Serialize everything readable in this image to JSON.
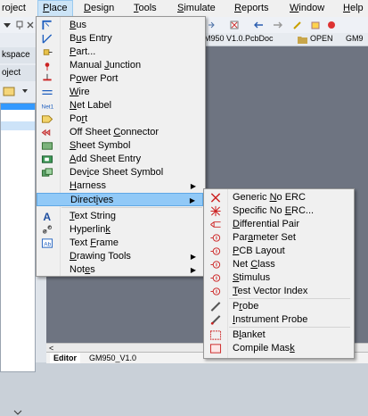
{
  "menubar": {
    "items": [
      {
        "label": "roject"
      },
      {
        "label": "Place",
        "acc": "P",
        "rest": "lace"
      },
      {
        "label": "Design",
        "acc": "D",
        "rest": "esign"
      },
      {
        "label": "Tools",
        "acc": "T",
        "rest": "ools"
      },
      {
        "label": "Simulate",
        "acc": "S",
        "rest": "imulate"
      },
      {
        "label": "Reports",
        "acc": "R",
        "rest": "eports"
      },
      {
        "label": "Window",
        "acc": "W",
        "rest": "indow"
      },
      {
        "label": "Help",
        "acc": "H",
        "rest": "elp"
      }
    ]
  },
  "toolbar": {
    "doc_text": "GM950 V1.0.PcbDoc",
    "open_text": "OPEN",
    "gm_text": "GM9"
  },
  "leftpanel": {
    "workspace_label": "kspace",
    "project_label": "oject"
  },
  "editor": {
    "scroll_left": "<",
    "tabs": [
      "Editor",
      "GM950_V1.0"
    ]
  },
  "place_menu": {
    "items": [
      {
        "pre": "",
        "acc": "B",
        "post": "us",
        "icon": "bus-icon"
      },
      {
        "pre": "B",
        "acc": "u",
        "post": "s Entry",
        "icon": "bus-entry-icon"
      },
      {
        "pre": "",
        "acc": "P",
        "post": "art...",
        "icon": "part-icon"
      },
      {
        "pre": "Manual ",
        "acc": "J",
        "post": "unction",
        "icon": "manual-junction-icon"
      },
      {
        "pre": "P",
        "acc": "o",
        "post": "wer Port",
        "icon": "power-port-icon"
      },
      {
        "pre": "",
        "acc": "W",
        "post": "ire",
        "icon": "wire-icon"
      },
      {
        "pre": "",
        "acc": "N",
        "post": "et Label",
        "icon": "net-label-icon"
      },
      {
        "pre": "Po",
        "acc": "r",
        "post": "t",
        "icon": "port-icon"
      },
      {
        "pre": "Off Sheet ",
        "acc": "C",
        "post": "onnector",
        "icon": "off-sheet-connector-icon"
      },
      {
        "pre": "",
        "acc": "S",
        "post": "heet Symbol",
        "icon": "sheet-symbol-icon"
      },
      {
        "pre": "",
        "acc": "A",
        "post": "dd Sheet Entry",
        "icon": "add-sheet-entry-icon"
      },
      {
        "pre": "Dev",
        "acc": "i",
        "post": "ce Sheet Symbol",
        "icon": "device-sheet-symbol-icon"
      },
      {
        "pre": "",
        "acc": "H",
        "post": "arness",
        "icon": "",
        "submenu": true
      },
      {
        "pre": "Direct",
        "acc": "i",
        "post": "ves",
        "icon": "",
        "submenu": true,
        "highlight": true
      },
      {
        "pre": "",
        "acc": "T",
        "post": "ext String",
        "icon": "text-string-icon"
      },
      {
        "pre": "Hyperlin",
        "acc": "k",
        "post": "",
        "icon": "hyperlink-icon"
      },
      {
        "pre": "Text ",
        "acc": "F",
        "post": "rame",
        "icon": "text-frame-icon"
      },
      {
        "pre": "",
        "acc": "D",
        "post": "rawing Tools",
        "icon": "",
        "submenu": true
      },
      {
        "pre": "Not",
        "acc": "e",
        "post": "s",
        "icon": "",
        "submenu": true
      }
    ]
  },
  "directives_menu": {
    "items": [
      {
        "pre": "Generic ",
        "acc": "N",
        "post": "o ERC",
        "icon": "generic-no-erc-icon"
      },
      {
        "pre": "Specific No ",
        "acc": "E",
        "post": "RC...",
        "icon": "specific-no-erc-icon"
      },
      {
        "pre": "",
        "acc": "D",
        "post": "ifferential Pair",
        "icon": "differential-pair-icon"
      },
      {
        "pre": "Par",
        "acc": "a",
        "post": "meter Set",
        "icon": "parameter-set-icon"
      },
      {
        "pre": "",
        "acc": "P",
        "post": "CB Layout",
        "icon": "pcb-layout-icon"
      },
      {
        "pre": "Net ",
        "acc": "C",
        "post": "lass",
        "icon": "net-class-icon"
      },
      {
        "pre": "",
        "acc": "S",
        "post": "timulus",
        "icon": "stimulus-icon"
      },
      {
        "pre": "",
        "acc": "T",
        "post": "est Vector Index",
        "icon": "test-vector-index-icon"
      },
      {
        "pre": "P",
        "acc": "r",
        "post": "obe",
        "icon": "probe-icon"
      },
      {
        "pre": "",
        "acc": "I",
        "post": "nstrument Probe",
        "icon": "instrument-probe-icon"
      },
      {
        "pre": "B",
        "acc": "l",
        "post": "anket",
        "icon": "blanket-icon"
      },
      {
        "pre": "Compile Mas",
        "acc": "k",
        "post": "",
        "icon": "compile-mask-icon"
      }
    ]
  },
  "submenu_arrow": "▶"
}
